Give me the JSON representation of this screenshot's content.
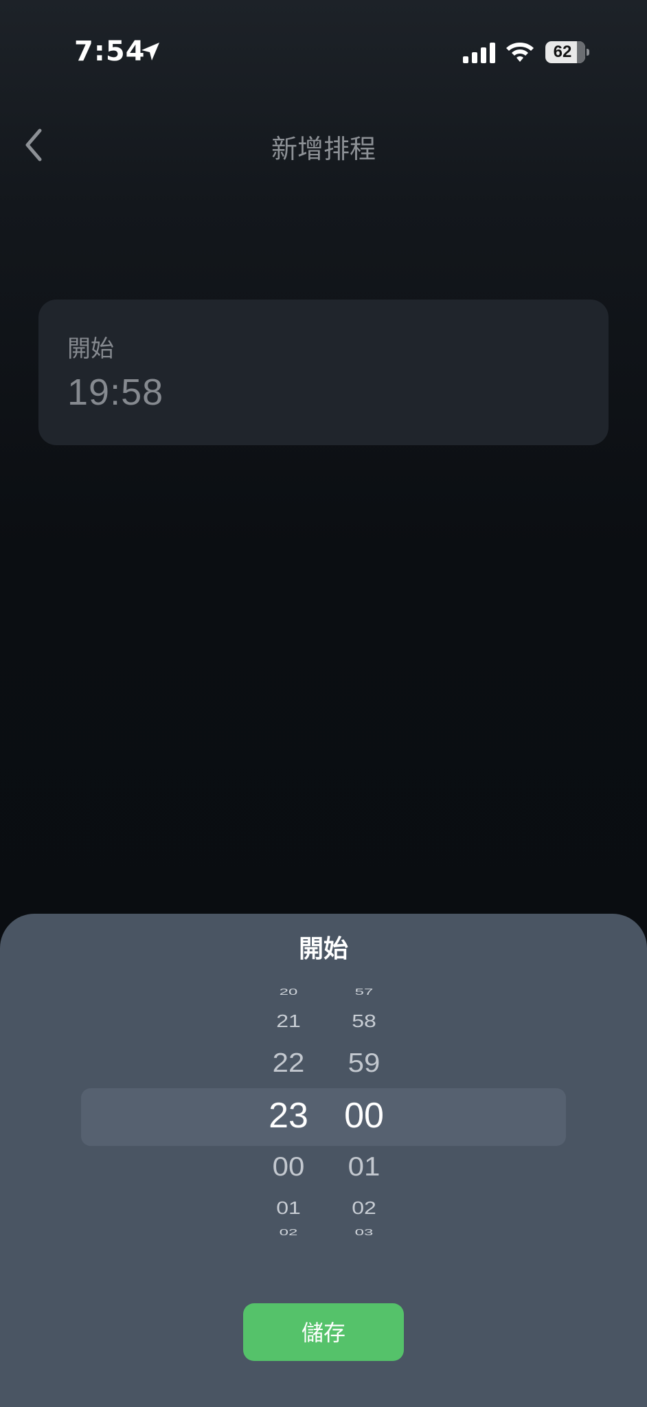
{
  "status_bar": {
    "time": "7:54",
    "battery": "62",
    "icons": [
      "location-arrow-icon",
      "cellular-signal-icon",
      "wifi-icon",
      "battery-icon"
    ]
  },
  "nav": {
    "back_icon": "chevron-left-icon",
    "title": "新增排程"
  },
  "start_card": {
    "label": "開始",
    "value": "19:58"
  },
  "sheet": {
    "title": "開始",
    "hours": [
      "20",
      "21",
      "22",
      "23",
      "00",
      "01",
      "02"
    ],
    "minutes": [
      "57",
      "58",
      "59",
      "00",
      "01",
      "02",
      "03"
    ],
    "selected_hour": "23",
    "selected_minute": "00",
    "save_label": "儲存"
  },
  "colors": {
    "sheet_bg": "#4a5563",
    "save_button": "#55c26a",
    "card_bg": "#20252c"
  }
}
